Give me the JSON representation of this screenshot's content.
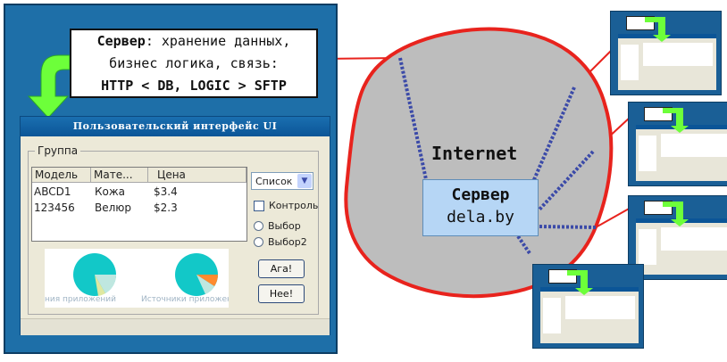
{
  "callout": {
    "line1_bold": "Сервер",
    "line1_rest": ": хранение данных,",
    "line2": "бизнес логика, связь:",
    "line3": "HTTP < DB, LOGIC > SFTP"
  },
  "window": {
    "title": "Пользовательский интерфейс UI",
    "group_label": "Группа",
    "columns": [
      "Модель",
      "Мате...",
      "Цена"
    ],
    "rows": [
      [
        "ABCD1",
        "Кожа",
        "$3.4"
      ],
      [
        "123456",
        "Велюр",
        "$2.3"
      ]
    ],
    "dropdown_value": "Список",
    "checkbox_label": "Контроль",
    "radio1_label": "Выбор",
    "radio2_label": "Выбор2",
    "button1_label": "Ага!",
    "button2_label": "Нее!",
    "pie1_caption": "ния приложений",
    "pie2_caption": "Источники приложений"
  },
  "cloud": {
    "label": "Internet",
    "server_title": "Сервер",
    "server_host": "dela.by"
  },
  "colors": {
    "panel_blue": "#1e6fa8",
    "cloud_fill": "#bdbdbd",
    "cloud_border": "#e8231d",
    "server_fill": "#b6d6f5",
    "link_dots": "#3b4aa8",
    "arrow_green": "#6dff3a"
  }
}
